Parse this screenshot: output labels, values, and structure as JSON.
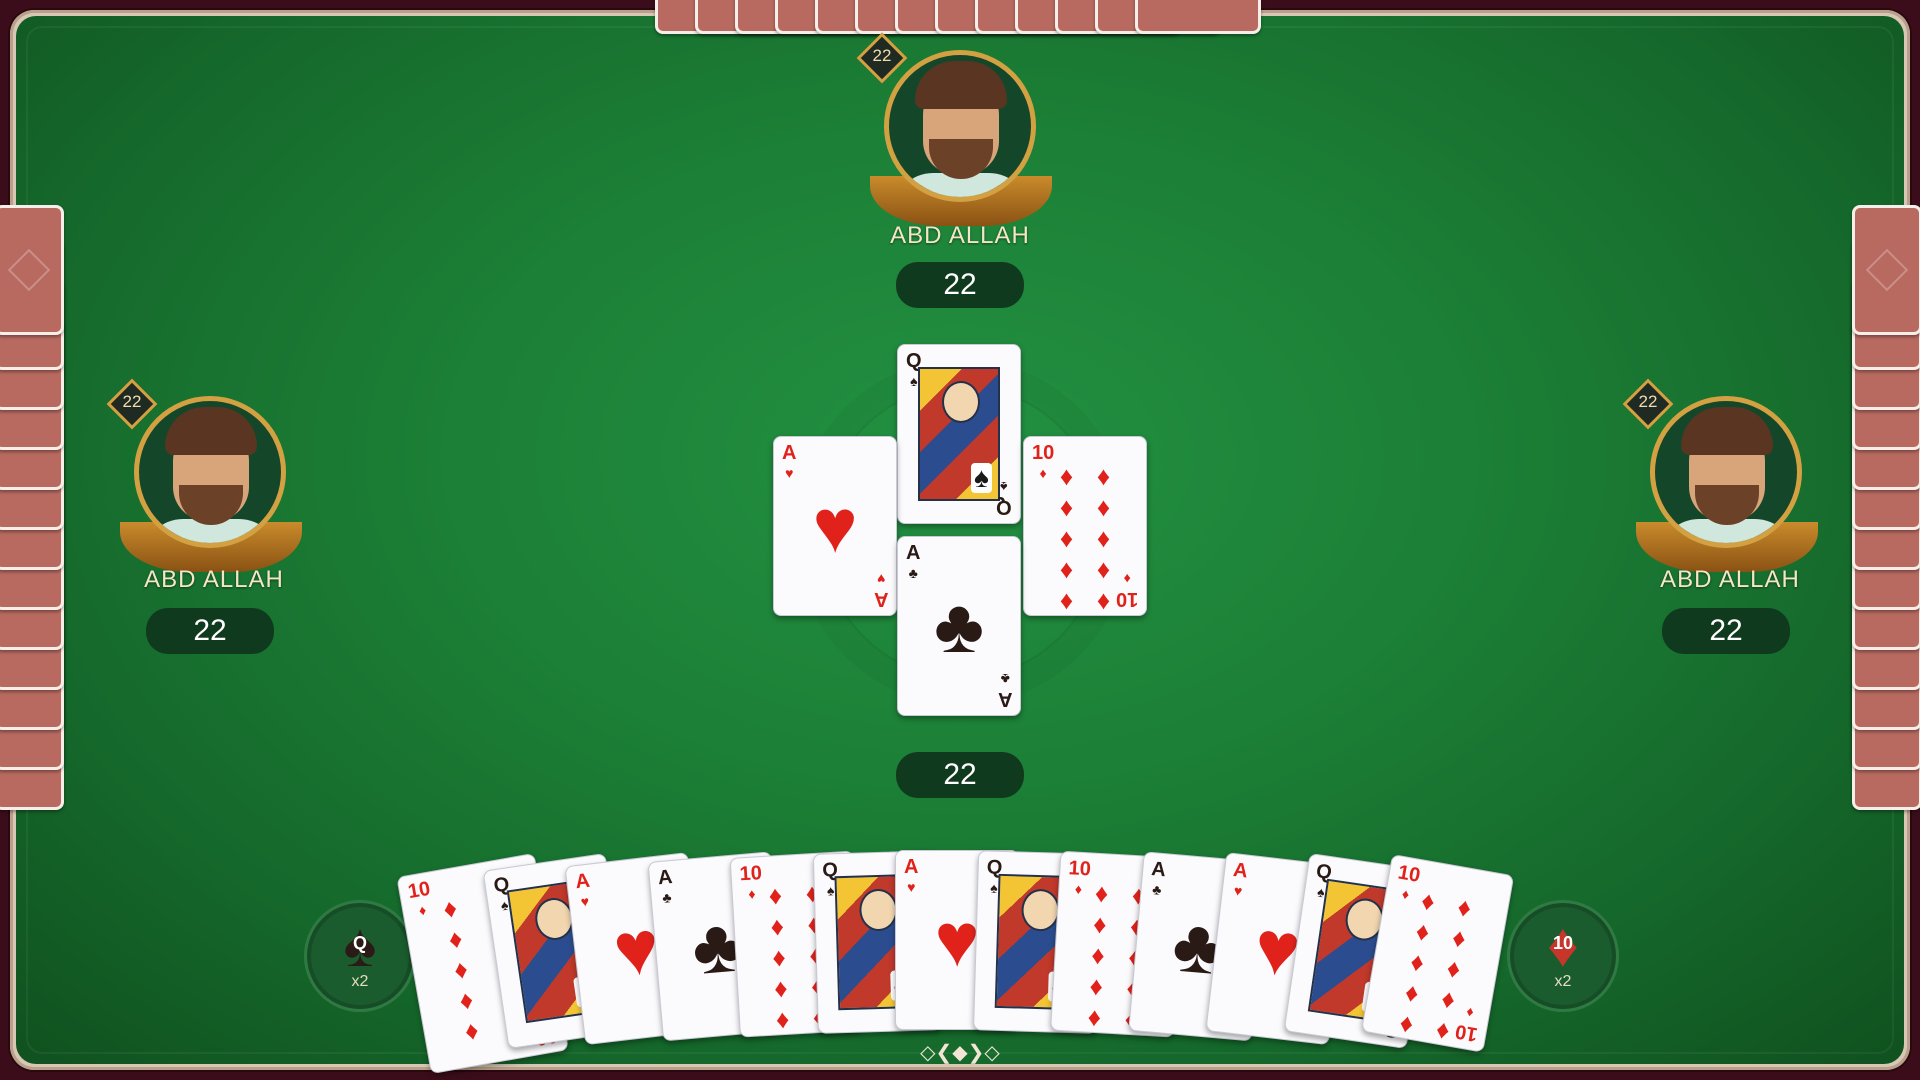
{
  "players": {
    "top": {
      "name": "ABD ALLAH",
      "score": "22",
      "level": "22"
    },
    "left": {
      "name": "ABD ALLAH",
      "score": "22",
      "level": "22"
    },
    "right": {
      "name": "ABD ALLAH",
      "score": "22",
      "level": "22"
    }
  },
  "self_score": "22",
  "trick": {
    "top": {
      "rank": "Q",
      "suit": "♠",
      "color": "black"
    },
    "left": {
      "rank": "A",
      "suit": "♥",
      "color": "red"
    },
    "right": {
      "rank": "10",
      "suit": "♦",
      "color": "red"
    },
    "bottom": {
      "rank": "A",
      "suit": "♣",
      "color": "black"
    }
  },
  "bonus_left": {
    "rank": "Q",
    "suit": "♠",
    "multiplier": "x2"
  },
  "bonus_right": {
    "rank": "10",
    "suit": "♦",
    "multiplier": "x2"
  },
  "hand": [
    {
      "rank": "10",
      "suit": "♦"
    },
    {
      "rank": "Q",
      "suit": "♠"
    },
    {
      "rank": "A",
      "suit": "♥"
    },
    {
      "rank": "A",
      "suit": "♣"
    },
    {
      "rank": "10",
      "suit": "♦"
    },
    {
      "rank": "Q",
      "suit": "♠"
    },
    {
      "rank": "A",
      "suit": "♥"
    },
    {
      "rank": "Q",
      "suit": "♠"
    },
    {
      "rank": "10",
      "suit": "♦"
    },
    {
      "rank": "A",
      "suit": "♣"
    },
    {
      "rank": "A",
      "suit": "♥"
    },
    {
      "rank": "Q",
      "suit": "♠"
    },
    {
      "rank": "10",
      "suit": "♦"
    }
  ]
}
